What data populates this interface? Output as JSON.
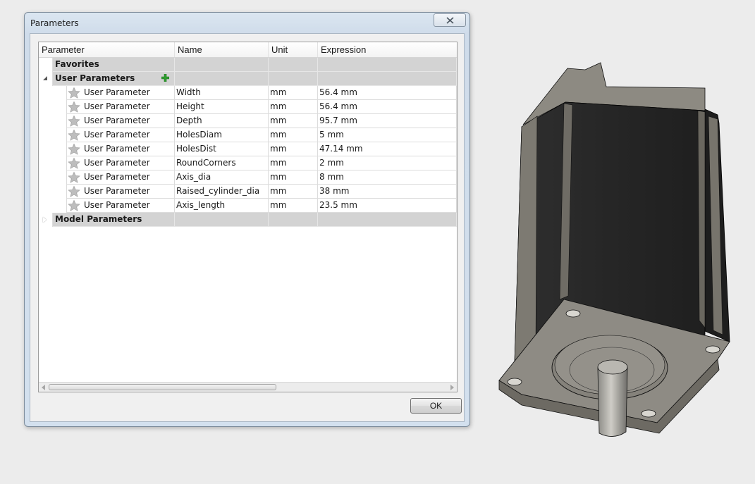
{
  "dialog": {
    "title": "Parameters",
    "ok_label": "OK"
  },
  "grid": {
    "columns": [
      "Parameter",
      "Name",
      "Unit",
      "Expression"
    ],
    "groups": {
      "favorites": "Favorites",
      "user": "User Parameters",
      "model": "Model Parameters"
    },
    "rows": [
      {
        "type": "User Parameter",
        "name": "Width",
        "unit": "mm",
        "expression": "56.4 mm"
      },
      {
        "type": "User Parameter",
        "name": "Height",
        "unit": "mm",
        "expression": "56.4 mm"
      },
      {
        "type": "User Parameter",
        "name": "Depth",
        "unit": "mm",
        "expression": "95.7 mm"
      },
      {
        "type": "User Parameter",
        "name": "HolesDiam",
        "unit": "mm",
        "expression": "5 mm"
      },
      {
        "type": "User Parameter",
        "name": "HolesDist",
        "unit": "mm",
        "expression": "47.14 mm"
      },
      {
        "type": "User Parameter",
        "name": "RoundCorners",
        "unit": "mm",
        "expression": "2 mm"
      },
      {
        "type": "User Parameter",
        "name": "Axis_dia",
        "unit": "mm",
        "expression": "8 mm"
      },
      {
        "type": "User Parameter",
        "name": "Raised_cylinder_dia",
        "unit": "mm",
        "expression": "38 mm"
      },
      {
        "type": "User Parameter",
        "name": "Axis_length",
        "unit": "mm",
        "expression": "23.5 mm"
      }
    ]
  },
  "icons": {
    "close": "close-icon",
    "star": "star-icon",
    "add": "add-parameter-icon",
    "expand": "expander-icon"
  },
  "colors": {
    "group_row": "#d3d3d3",
    "add_icon": "#2e9e2e",
    "star": "#b9b9b9"
  }
}
